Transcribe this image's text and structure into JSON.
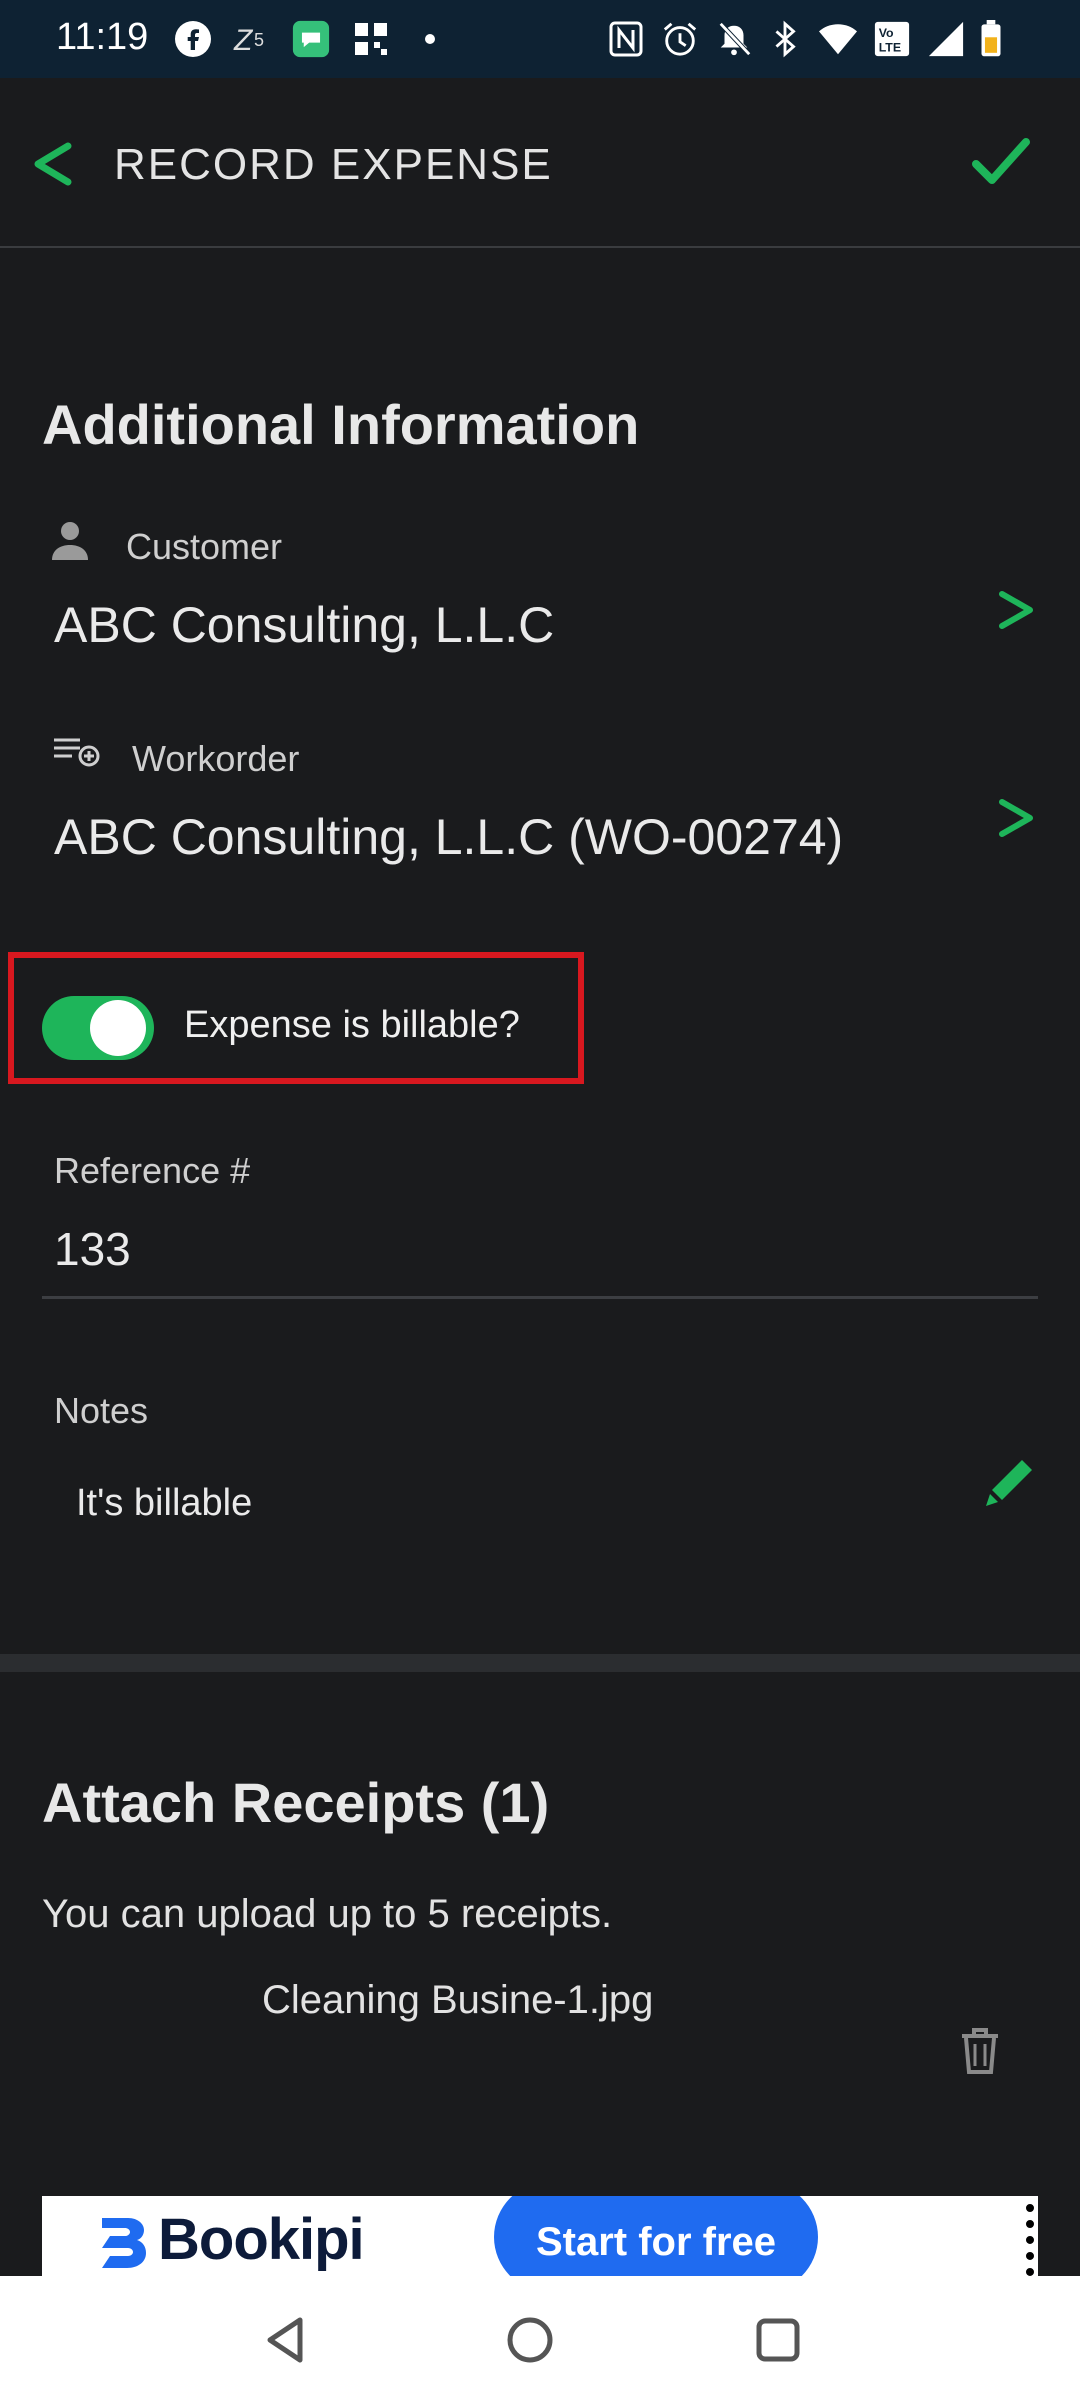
{
  "status_bar": {
    "time": "11:19",
    "left_icons": [
      "facebook-icon",
      "zee5-icon",
      "messages-icon",
      "app-grid-icon",
      "dot-icon"
    ],
    "right_icons": [
      "nfc-icon",
      "alarm-icon",
      "mute-icon",
      "bluetooth-icon",
      "wifi-icon",
      "volte-icon",
      "signal-icon",
      "battery-icon"
    ]
  },
  "app_bar": {
    "title": "RECORD EXPENSE",
    "back_icon": "back-chevron-icon",
    "confirm_icon": "check-icon"
  },
  "additional_info": {
    "title": "Additional Information",
    "customer": {
      "label": "Customer",
      "value": "ABC Consulting, L.L.C"
    },
    "workorder": {
      "label": "Workorder",
      "value": "ABC Consulting, L.L.C (WO-00274)"
    },
    "billable": {
      "label": "Expense is billable?",
      "on": true
    },
    "reference": {
      "label": "Reference #",
      "value": "133"
    },
    "notes": {
      "label": "Notes",
      "value": "It's billable"
    }
  },
  "receipts": {
    "title": "Attach Receipts (1)",
    "subtitle": "You can upload up to 5 receipts.",
    "files": [
      "Cleaning Busine-1.jpg"
    ]
  },
  "ad": {
    "brand": "Bookipi",
    "cta": "Start for free"
  },
  "colors": {
    "accent": "#1eb55a",
    "background": "#1a1b1d",
    "highlight": "#d8181f"
  }
}
